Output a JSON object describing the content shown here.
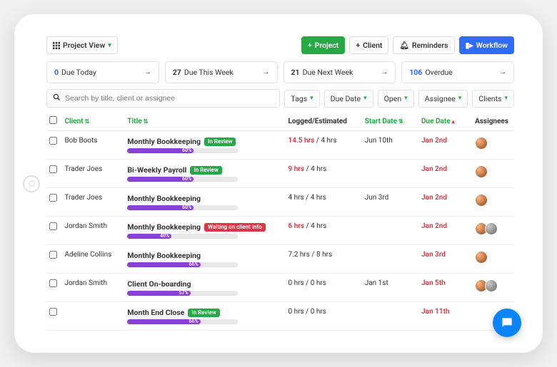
{
  "toolbar": {
    "view_label": "Project View",
    "project_btn": "Project",
    "client_btn": "Client",
    "reminders_btn": "Reminders",
    "workflow_btn": "Workflow"
  },
  "summary": [
    {
      "count": "0",
      "label": "Due Today",
      "cls": "due-today"
    },
    {
      "count": "27",
      "label": "Due This Week",
      "cls": ""
    },
    {
      "count": "21",
      "label": "Due Next Week",
      "cls": ""
    },
    {
      "count": "106",
      "label": "Overdue",
      "cls": "overdue"
    }
  ],
  "search": {
    "placeholder": "Search by title, client or assignee"
  },
  "filters": {
    "tags": "Tags",
    "due_date": "Due Date",
    "open": "Open",
    "assignee": "Assignee",
    "clients": "Clients"
  },
  "columns": {
    "client": "Client",
    "title": "Title",
    "logged": "Logged/Estimated",
    "start": "Start Date",
    "due": "Due Date",
    "assignees": "Assignees"
  },
  "rows": [
    {
      "client": "Bob Boots",
      "title": "Monthly Bookkeeping",
      "badge": "In Review",
      "badge_cls": "badge-green",
      "pct": 60,
      "logged": "14.5 hrs",
      "est": "4 hrs",
      "over": true,
      "start": "Jun 10th",
      "due": "Jan 2nd",
      "avatars": [
        "av1"
      ]
    },
    {
      "client": "Trader Joes",
      "title": "Bi-Weekly Payroll",
      "badge": "In Review",
      "badge_cls": "badge-green",
      "pct": 60,
      "logged": "9 hrs",
      "est": "4 hrs",
      "over": true,
      "start": "",
      "due": "Jan 2nd",
      "avatars": [
        "av1"
      ]
    },
    {
      "client": "Trader Joes",
      "title": "Monthly Bookkeeping",
      "badge": "",
      "badge_cls": "",
      "pct": 60,
      "logged": "4 hrs",
      "est": "4 hrs",
      "over": false,
      "start": "Jun 3rd",
      "due": "Jan 2nd",
      "avatars": [
        "av1"
      ]
    },
    {
      "client": "Jordan Smith",
      "title": "Monthly Bookkeeping",
      "badge": "Waiting on client info",
      "badge_cls": "badge-red",
      "pct": 40,
      "logged": "6 hrs",
      "est": "4 hrs",
      "over": true,
      "start": "",
      "due": "Jan 2nd",
      "avatars": [
        "av1",
        "av2"
      ]
    },
    {
      "client": "Adeline Collins",
      "title": "Monthly Bookkeeping",
      "badge": "",
      "badge_cls": "",
      "pct": 66,
      "logged": "7.2 hrs",
      "est": "8 hrs",
      "over": false,
      "start": "",
      "due": "Jan 3rd",
      "avatars": [
        "av1"
      ]
    },
    {
      "client": "Jordan Smith",
      "title": "Client On-boarding",
      "badge": "",
      "badge_cls": "",
      "pct": 57,
      "logged": "0 hrs",
      "est": "0 hrs",
      "over": false,
      "start": "Jan 1st",
      "due": "Jan 5th",
      "avatars": [
        "av1",
        "av2"
      ]
    },
    {
      "client": "",
      "title": "Month End Close",
      "badge": "In Review",
      "badge_cls": "badge-green",
      "pct": 66,
      "logged": "0 hrs",
      "est": "0 hrs",
      "over": false,
      "start": "",
      "due": "Jan 11th",
      "avatars": []
    }
  ]
}
